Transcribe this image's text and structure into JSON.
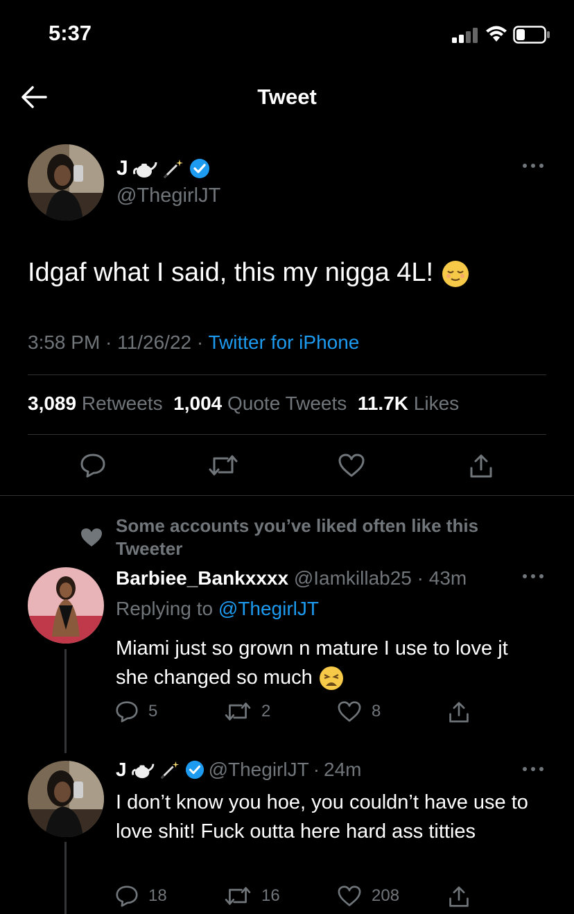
{
  "status_bar": {
    "time": "5:37"
  },
  "nav": {
    "title": "Tweet"
  },
  "tweet": {
    "author_name": "J",
    "author_name_emoji": "🫖🪄",
    "handle": "@ThegirlJT",
    "text": "Idgaf what I said, this my nigga 4L!",
    "time": "3:58 PM",
    "date": "11/26/22",
    "source": "Twitter for iPhone",
    "retweets_count": "3,089",
    "retweets_label": "Retweets",
    "quotes_count": "1,004",
    "quotes_label": "Quote Tweets",
    "likes_count": "11.7K",
    "likes_label": "Likes"
  },
  "social_context": {
    "text": "Some accounts you’ve liked often like this Tweeter"
  },
  "replies": [
    {
      "name": "Barbiee_Bankxxxx",
      "handle": "@Iamkillab25",
      "time": "43m",
      "replying_label": "Replying to",
      "replying_to": "@ThegirlJT",
      "text": "Miami just so grown n mature I use to love jt she changed so much",
      "reply_count": "5",
      "retweet_count": "2",
      "like_count": "8"
    },
    {
      "name": "J",
      "handle": "@ThegirlJT",
      "time": "24m",
      "text": "I don’t know you hoe, you couldn’t have use to love shit! Fuck outta here hard ass titties",
      "reply_count": "18",
      "retweet_count": "16",
      "like_count": "208"
    }
  ],
  "colors": {
    "accent": "#1d9bf0",
    "muted": "#71767b",
    "background": "#000000"
  }
}
